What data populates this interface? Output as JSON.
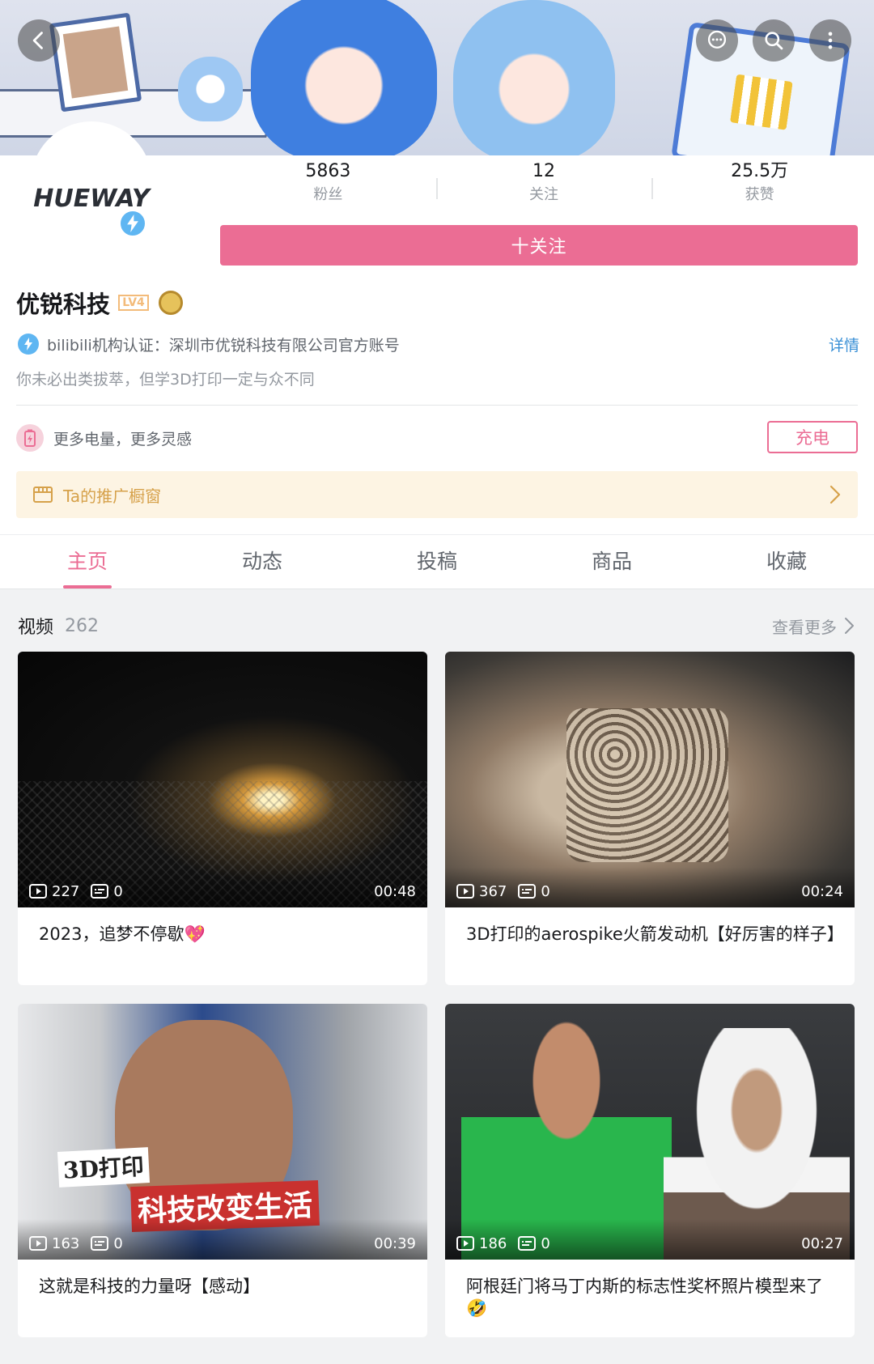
{
  "header": {
    "back_icon": "chevron-left-icon",
    "actions": [
      "chat-bubble-icon",
      "search-icon",
      "more-vertical-icon"
    ]
  },
  "profile": {
    "avatar_logo": "HUEWAY",
    "stats": [
      {
        "value": "5863",
        "label": "粉丝"
      },
      {
        "value": "12",
        "label": "关注"
      },
      {
        "value": "25.5万",
        "label": "获赞"
      }
    ],
    "follow_label": "十关注",
    "name": "优锐科技",
    "level": "LV4",
    "certification": "bilibili机构认证：深圳市优锐科技有限公司官方账号",
    "detail_label": "详情",
    "sign": "你未必出类拔萃，但学3D打印一定与众不同",
    "charge_text": "更多电量，更多灵感",
    "charge_button": "充电",
    "shop_text": "Ta的推广橱窗"
  },
  "tabs": [
    {
      "label": "主页",
      "active": true
    },
    {
      "label": "动态",
      "active": false
    },
    {
      "label": "投稿",
      "active": false
    },
    {
      "label": "商品",
      "active": false
    },
    {
      "label": "收藏",
      "active": false
    }
  ],
  "videos_section": {
    "title": "视频",
    "count": "262",
    "more_label": "查看更多"
  },
  "videos": [
    {
      "views": "227",
      "comments": "0",
      "duration": "00:48",
      "title": "2023，追梦不停歇💖"
    },
    {
      "views": "367",
      "comments": "0",
      "duration": "00:24",
      "title": "3D打印的aerospike火箭发动机【好厉害的样子】"
    },
    {
      "views": "163",
      "comments": "0",
      "duration": "00:39",
      "title": "这就是科技的力量呀【感动】",
      "thumb_text_1": "3D打印",
      "thumb_text_2": "科技改变生活"
    },
    {
      "views": "186",
      "comments": "0",
      "duration": "00:27",
      "title": "阿根廷门将马丁内斯的标志性奖杯照片模型来了🤣"
    }
  ],
  "colors": {
    "accent_pink": "#eb6d94",
    "link_blue": "#3a90d6",
    "shop_orange": "#d6a14a"
  }
}
